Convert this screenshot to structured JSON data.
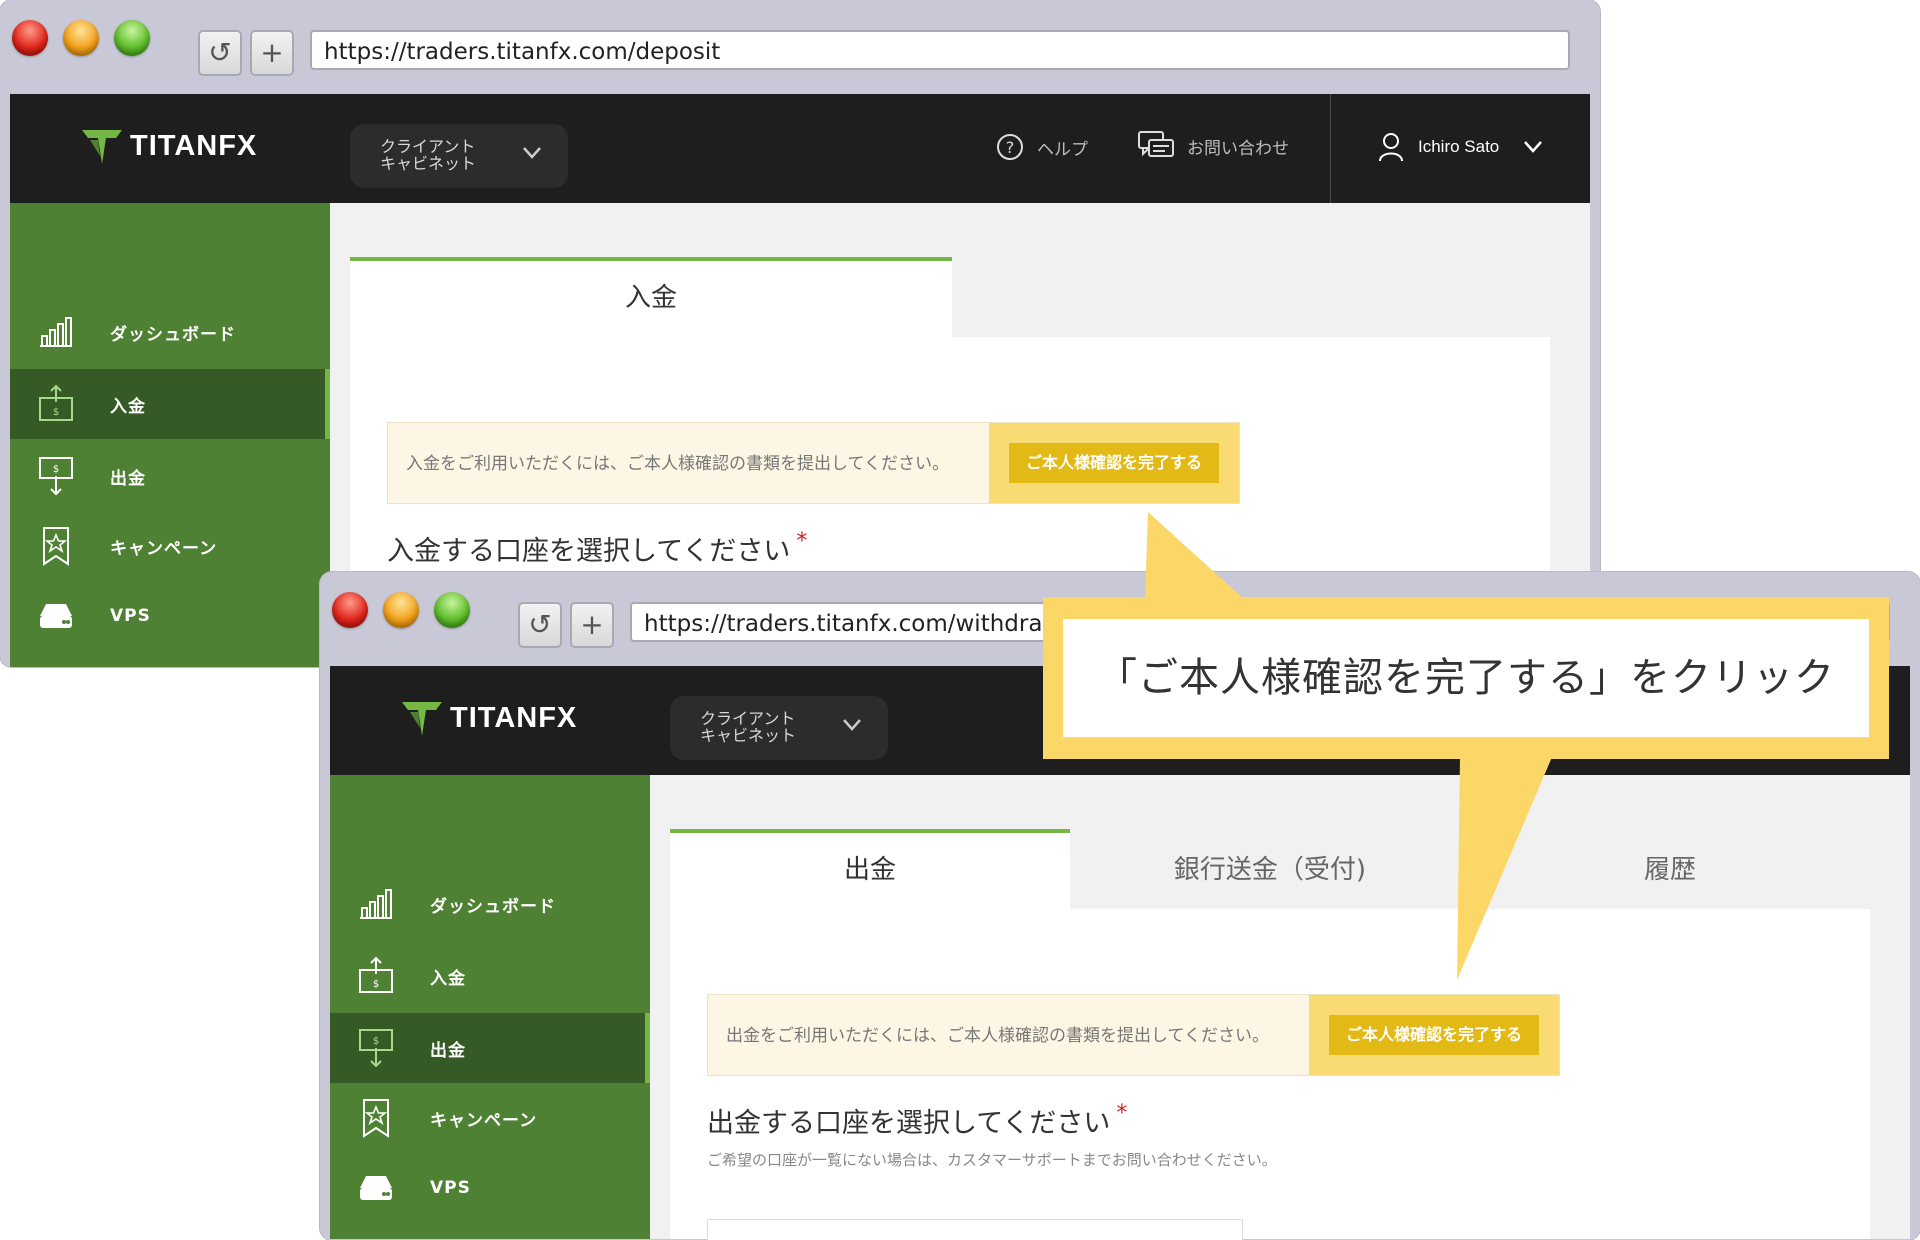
{
  "windows": {
    "back": {
      "url": "https://traders.titanfx.com/deposit",
      "logo": "TITANFX",
      "cabinet_label": "クライアント\nキャビネット",
      "help_label": "ヘルプ",
      "contact_label": "お問い合わせ",
      "user_name": "Ichiro Sato",
      "sidebar": [
        {
          "label": "ダッシュボード",
          "icon": "chart-bars-icon",
          "active": false
        },
        {
          "label": "入金",
          "icon": "deposit-icon",
          "active": true
        },
        {
          "label": "出金",
          "icon": "withdraw-icon",
          "active": false
        },
        {
          "label": "キャンペーン",
          "icon": "ribbon-star-icon",
          "active": false
        },
        {
          "label": "VPS",
          "icon": "server-icon",
          "active": false
        }
      ],
      "tabs": [
        "入金"
      ],
      "notice_text": "入金をご利用いただくには、ご本人様確認の書類を提出してください。",
      "notice_button": "ご本人様確認を完了する",
      "select_title": "入金する口座を選択してください",
      "required_mark": "*"
    },
    "front": {
      "url": "https://traders.titanfx.com/withdraw",
      "logo": "TITANFX",
      "cabinet_label": "クライアント\nキャビネット",
      "sidebar": [
        {
          "label": "ダッシュボード",
          "icon": "chart-bars-icon",
          "active": false
        },
        {
          "label": "入金",
          "icon": "deposit-icon",
          "active": false
        },
        {
          "label": "出金",
          "icon": "withdraw-icon",
          "active": true
        },
        {
          "label": "キャンペーン",
          "icon": "ribbon-star-icon",
          "active": false
        },
        {
          "label": "VPS",
          "icon": "server-icon",
          "active": false
        }
      ],
      "tabs": [
        "出金",
        "銀行送金（受付)",
        "履歴"
      ],
      "notice_text": "出金をご利用いただくには、ご本人様確認の書類を提出してください。",
      "notice_button": "ご本人様確認を完了する",
      "select_title": "出金する口座を選択してください",
      "required_mark": "*",
      "hint": "ご希望の口座が一覧にない場合は、カスタマーサポートまでお問い合わせください。"
    }
  },
  "callout": {
    "text": "「ご本人様確認を完了する」をクリック"
  },
  "colors": {
    "header_bg": "#1e1e1e",
    "sidebar_green": "#4e8134",
    "sidebar_active": "#365a25",
    "accent_green": "#74b744",
    "callout_yellow": "#fbd768",
    "button_yellow": "#e2b915"
  }
}
